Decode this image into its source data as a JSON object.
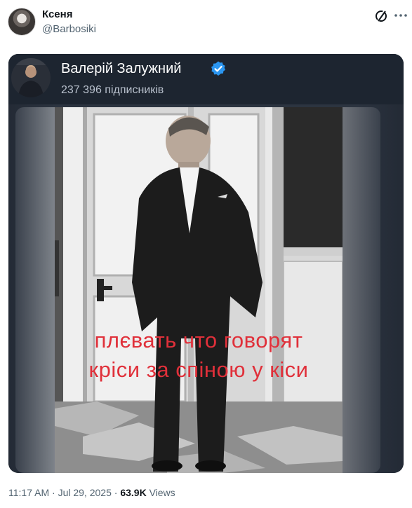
{
  "tweet": {
    "author_name": "Ксеня",
    "author_handle": "@Barbosiki",
    "grok_icon": "grok-icon",
    "more_icon": "more-icon"
  },
  "embedded": {
    "channel_name": "Валерій Залужний",
    "subscribers": "237 396 підписників",
    "verified_color": "#1d9bf0",
    "caption_line1": "плєвать что говорят",
    "caption_line2": "кріси за спіною у кіси",
    "caption_color": "#e0303a"
  },
  "meta": {
    "time": "11:17 AM",
    "sep": "·",
    "date": "Jul 29, 2025",
    "sep2": "·",
    "views_count": "63.9K",
    "views_label": "Views"
  }
}
